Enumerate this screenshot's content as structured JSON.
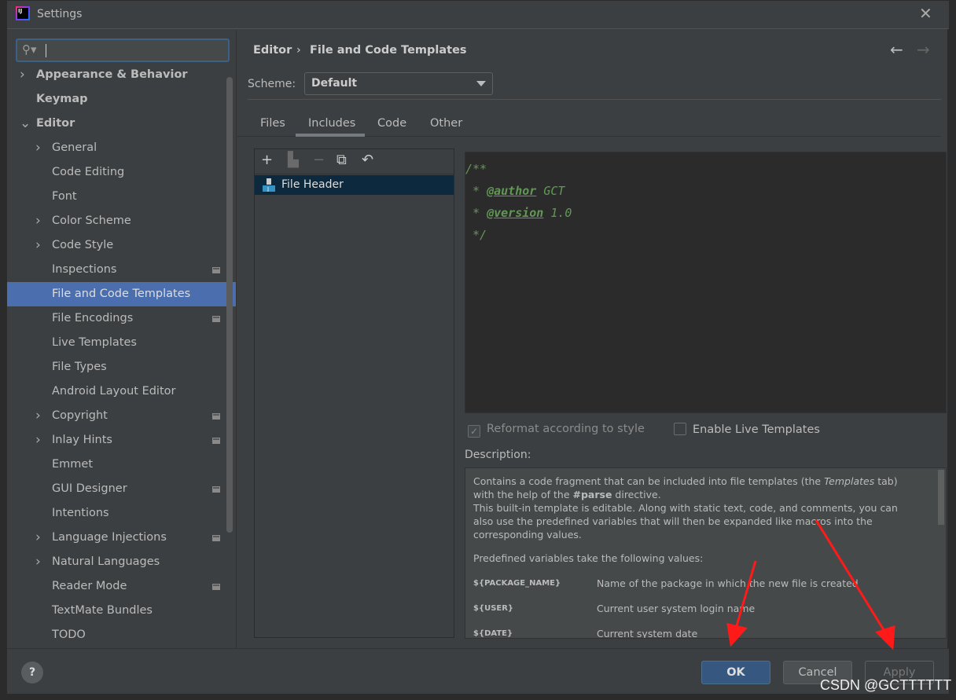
{
  "window": {
    "title": "Settings",
    "close_icon": "close-icon"
  },
  "search": {
    "value": "",
    "placeholder": ""
  },
  "sidebar": {
    "items": [
      {
        "label": "Appearance & Behavior",
        "level": 0,
        "chevron": "right",
        "bold": true
      },
      {
        "label": "Keymap",
        "level": 0,
        "bold": true
      },
      {
        "label": "Editor",
        "level": 0,
        "chevron": "down",
        "bold": true
      },
      {
        "label": "General",
        "level": 1,
        "chevron": "right"
      },
      {
        "label": "Code Editing",
        "level": 1
      },
      {
        "label": "Font",
        "level": 1
      },
      {
        "label": "Color Scheme",
        "level": 1,
        "chevron": "right"
      },
      {
        "label": "Code Style",
        "level": 1,
        "chevron": "right"
      },
      {
        "label": "Inspections",
        "level": 1,
        "mark": true
      },
      {
        "label": "File and Code Templates",
        "level": 1,
        "selected": true
      },
      {
        "label": "File Encodings",
        "level": 1,
        "mark": true
      },
      {
        "label": "Live Templates",
        "level": 1
      },
      {
        "label": "File Types",
        "level": 1
      },
      {
        "label": "Android Layout Editor",
        "level": 1
      },
      {
        "label": "Copyright",
        "level": 1,
        "chevron": "right",
        "mark": true
      },
      {
        "label": "Inlay Hints",
        "level": 1,
        "chevron": "right",
        "mark": true
      },
      {
        "label": "Emmet",
        "level": 1
      },
      {
        "label": "GUI Designer",
        "level": 1,
        "mark": true
      },
      {
        "label": "Intentions",
        "level": 1
      },
      {
        "label": "Language Injections",
        "level": 1,
        "chevron": "right",
        "mark": true
      },
      {
        "label": "Natural Languages",
        "level": 1,
        "chevron": "right"
      },
      {
        "label": "Reader Mode",
        "level": 1,
        "mark": true
      },
      {
        "label": "TextMate Bundles",
        "level": 1
      },
      {
        "label": "TODO",
        "level": 1
      }
    ]
  },
  "breadcrumb": {
    "parent": "Editor",
    "separator": "›",
    "current": "File and Code Templates"
  },
  "scheme": {
    "label": "Scheme:",
    "value": "Default"
  },
  "tabs": [
    {
      "label": "Files"
    },
    {
      "label": "Includes",
      "active": true
    },
    {
      "label": "Code"
    },
    {
      "label": "Other"
    }
  ],
  "templates": {
    "items": [
      {
        "label": "File Header"
      }
    ]
  },
  "editor": {
    "lines": [
      {
        "pre": "/**",
        "tag": "",
        "post": ""
      },
      {
        "pre": " * ",
        "tag": "@author",
        "post": " GCT"
      },
      {
        "pre": " * ",
        "tag": "@version",
        "post": " 1.0"
      },
      {
        "pre": " */",
        "tag": "",
        "post": ""
      }
    ]
  },
  "options": {
    "reformat": {
      "label": "Reformat according to style",
      "checked": true,
      "disabled": true
    },
    "live_templates": {
      "label": "Enable Live Templates",
      "checked": false
    }
  },
  "description": {
    "label": "Description:",
    "p1_a": "Contains a code fragment that can be included into file templates (the ",
    "p1_em": "Templates",
    "p1_b": " tab) with the help of the ",
    "p1_strong": "#parse",
    "p1_c": " directive.",
    "p2": "This built-in template is editable. Along with static text, code, and comments, you can also use the predefined variables that will then be expanded like macros into the corresponding values.",
    "p3": "Predefined variables take the following values:",
    "vars": [
      {
        "name": "${PACKAGE_NAME}",
        "desc": "Name of the package in which the new file is created"
      },
      {
        "name": "${USER}",
        "desc": "Current user system login name"
      },
      {
        "name": "${DATE}",
        "desc": "Current system date"
      }
    ]
  },
  "footer": {
    "help": "?",
    "ok": "OK",
    "cancel": "Cancel",
    "apply": "Apply"
  },
  "watermark": "CSDN @GCTTTTTT",
  "colors": {
    "selection": "#4b6eaf",
    "background": "#3c3f41",
    "comment": "#629755",
    "annotation_arrows": "#ff1a1a"
  }
}
